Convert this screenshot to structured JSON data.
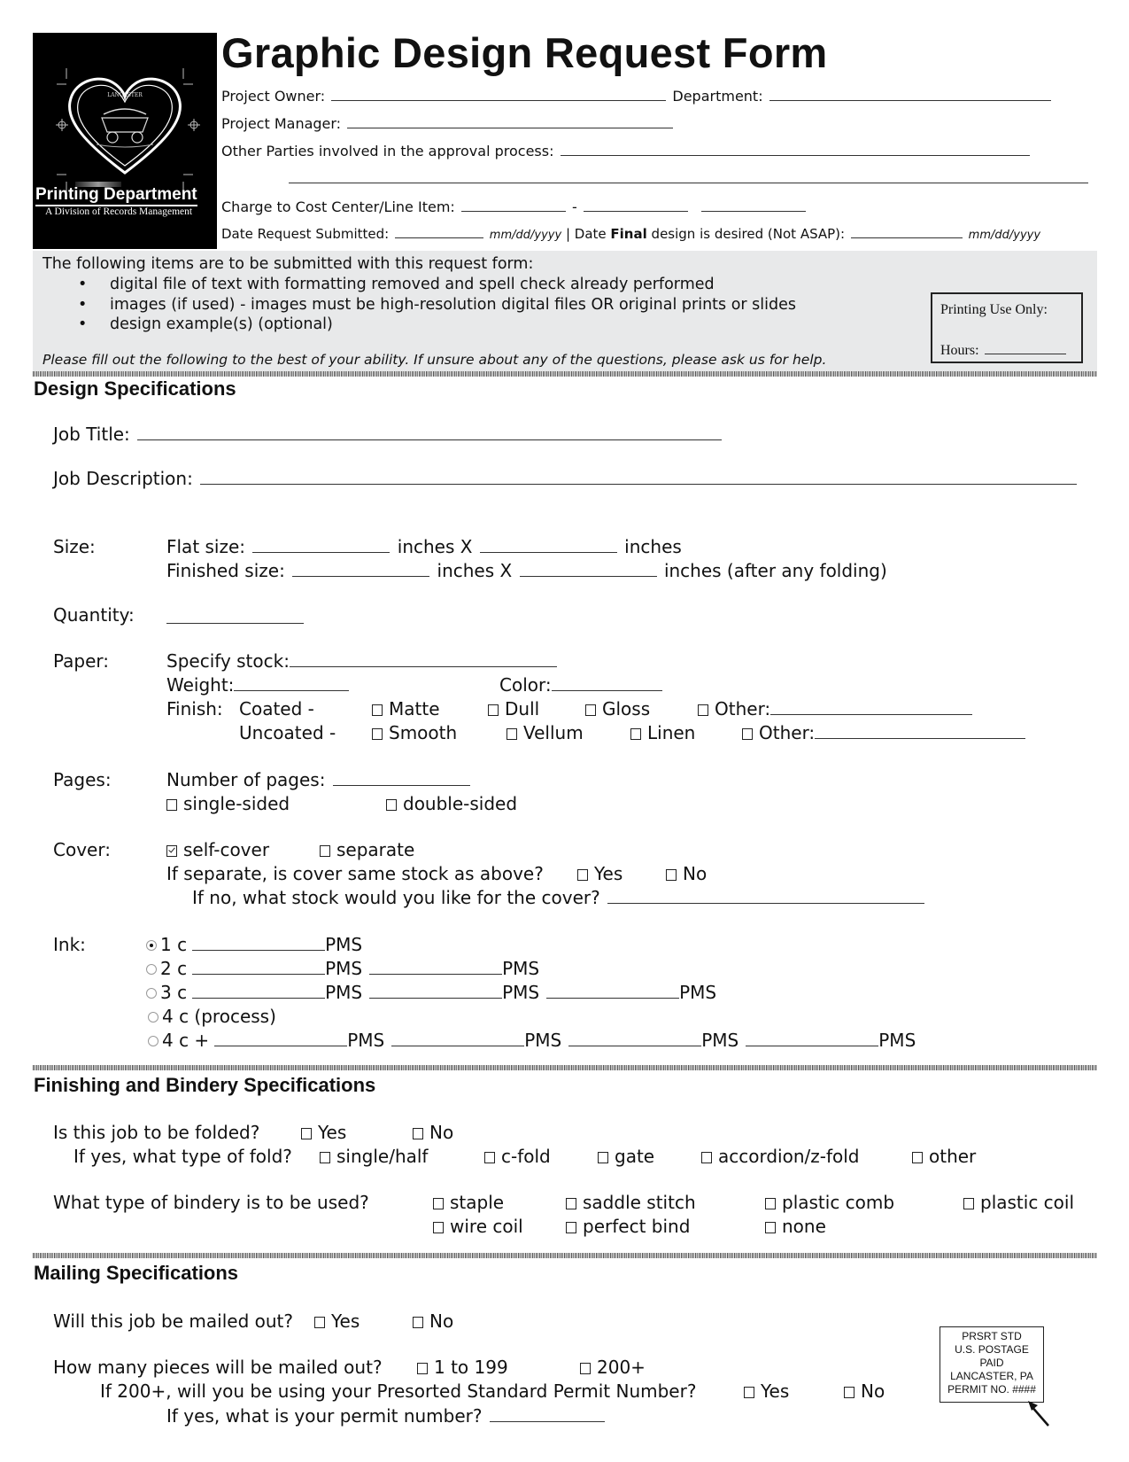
{
  "header": {
    "title": "Graphic Design Request Form",
    "logo": {
      "dept_name": "Printing Department",
      "division": "A Division of Records Management",
      "seal_text": "COUNTY OF LANCASTER, PENNSYLVANIA",
      "icon": "county-seal-heart-icon"
    },
    "project_owner_label": "Project Owner:",
    "department_label": "Department:",
    "project_manager_label": "Project Manager:",
    "other_parties_label": "Other Parties involved in the approval process:",
    "charge_label": "Charge to Cost Center/Line Item:",
    "charge_sep": "-",
    "date_submitted_label": "Date Request Submitted:",
    "date_format": "mm/dd/yyyy",
    "date_sep": "|",
    "date_final_pre": "Date",
    "date_final_bold": "Final",
    "date_final_post": "design is desired (Not ASAP):"
  },
  "requirements": {
    "intro": "The following items are to be submitted with this request form:",
    "items": [
      "digital file of text with formatting removed and spell check already performed",
      "images (if used) - images must be high-resolution digital files OR original prints or slides",
      "design example(s) (optional)"
    ],
    "note": "Please fill out the following to the best of your ability.  If unsure about any of the questions, please ask us for help.",
    "printing_use_label": "Printing Use Only:",
    "hours_label": "Hours:"
  },
  "design": {
    "title": "Design Specifications",
    "job_title_label": "Job Title:",
    "job_description_label": "Job Description:",
    "size_label": "Size:",
    "flat_size_label": "Flat size:",
    "finished_size_label": "Finished size:",
    "inches_x": "inches X",
    "inches": "inches",
    "inches_after": "inches (after any folding)",
    "quantity_label": "Quantity:",
    "paper_label": "Paper:",
    "specify_stock_label": "Specify stock:",
    "weight_label": "Weight:",
    "color_label": "Color:",
    "finish_label": "Finish:",
    "coated_label": "Coated -",
    "uncoated_label": "Uncoated -",
    "coated_options": [
      {
        "label": "Matte",
        "checked": false
      },
      {
        "label": "Dull",
        "checked": false
      },
      {
        "label": "Gloss",
        "checked": false
      },
      {
        "label": "Other:",
        "checked": false
      }
    ],
    "uncoated_options": [
      {
        "label": "Smooth",
        "checked": false
      },
      {
        "label": "Vellum",
        "checked": false
      },
      {
        "label": "Linen",
        "checked": false
      },
      {
        "label": "Other:",
        "checked": false
      }
    ],
    "pages_label": "Pages:",
    "number_of_pages_label": "Number of pages:",
    "sided_options": [
      {
        "label": "single-sided",
        "checked": false
      },
      {
        "label": "double-sided",
        "checked": false
      }
    ],
    "cover_label": "Cover:",
    "cover_options": [
      {
        "label": "self-cover",
        "checked": true
      },
      {
        "label": "separate",
        "checked": false
      }
    ],
    "cover_same_question": "If separate, is cover same stock as above?",
    "cover_same_options": [
      {
        "label": "Yes",
        "checked": false
      },
      {
        "label": "No",
        "checked": false
      }
    ],
    "cover_stock_question": "If no, what stock would you like for the cover?",
    "ink_label": "Ink:",
    "pms": "PMS",
    "ink_options": [
      {
        "label": "1 c",
        "selected": true,
        "pms_count": 1
      },
      {
        "label": "2 c",
        "selected": false,
        "pms_count": 2
      },
      {
        "label": "3 c",
        "selected": false,
        "pms_count": 3
      },
      {
        "label": "4 c (process)",
        "selected": false,
        "pms_count": 0
      },
      {
        "label": "4 c +",
        "selected": false,
        "pms_count": 4
      }
    ]
  },
  "finishing": {
    "title": "Finishing and Bindery Specifications",
    "folded_question": "Is this job to be folded?",
    "folded_options": [
      {
        "label": "Yes",
        "checked": false
      },
      {
        "label": "No",
        "checked": false
      }
    ],
    "fold_type_question": "If yes, what type of fold?",
    "fold_types": [
      {
        "label": "single/half",
        "checked": false
      },
      {
        "label": "c-fold",
        "checked": false
      },
      {
        "label": "gate",
        "checked": false
      },
      {
        "label": "accordion/z-fold",
        "checked": false
      },
      {
        "label": "other",
        "checked": false
      }
    ],
    "bindery_question": "What type of bindery is to be used?",
    "bindery_options": [
      {
        "label": "staple",
        "checked": false
      },
      {
        "label": "saddle stitch",
        "checked": false
      },
      {
        "label": "plastic comb",
        "checked": false
      },
      {
        "label": "plastic coil",
        "checked": false
      },
      {
        "label": "wire coil",
        "checked": false
      },
      {
        "label": "perfect bind",
        "checked": false
      },
      {
        "label": "none",
        "checked": false
      }
    ]
  },
  "mailing": {
    "title": "Mailing Specifications",
    "mailed_question": "Will this job be mailed out?",
    "mailed_options": [
      {
        "label": "Yes",
        "checked": false
      },
      {
        "label": "No",
        "checked": false
      }
    ],
    "pieces_question": "How many pieces will be mailed out?",
    "pieces_options": [
      {
        "label": "1 to 199",
        "checked": false
      },
      {
        "label": "200+",
        "checked": false
      }
    ],
    "permit_question": "If 200+, will you be using your Presorted Standard Permit Number?",
    "permit_options": [
      {
        "label": "Yes",
        "checked": false
      },
      {
        "label": "No",
        "checked": false
      }
    ],
    "permit_number_question": "If yes, what is your permit number?",
    "indicia": {
      "lines": [
        "PRSRT STD",
        "U.S. POSTAGE",
        "PAID",
        "LANCASTER, PA",
        "PERMIT NO. ####"
      ],
      "pointer_icon": "arrow-pointer-icon"
    }
  }
}
